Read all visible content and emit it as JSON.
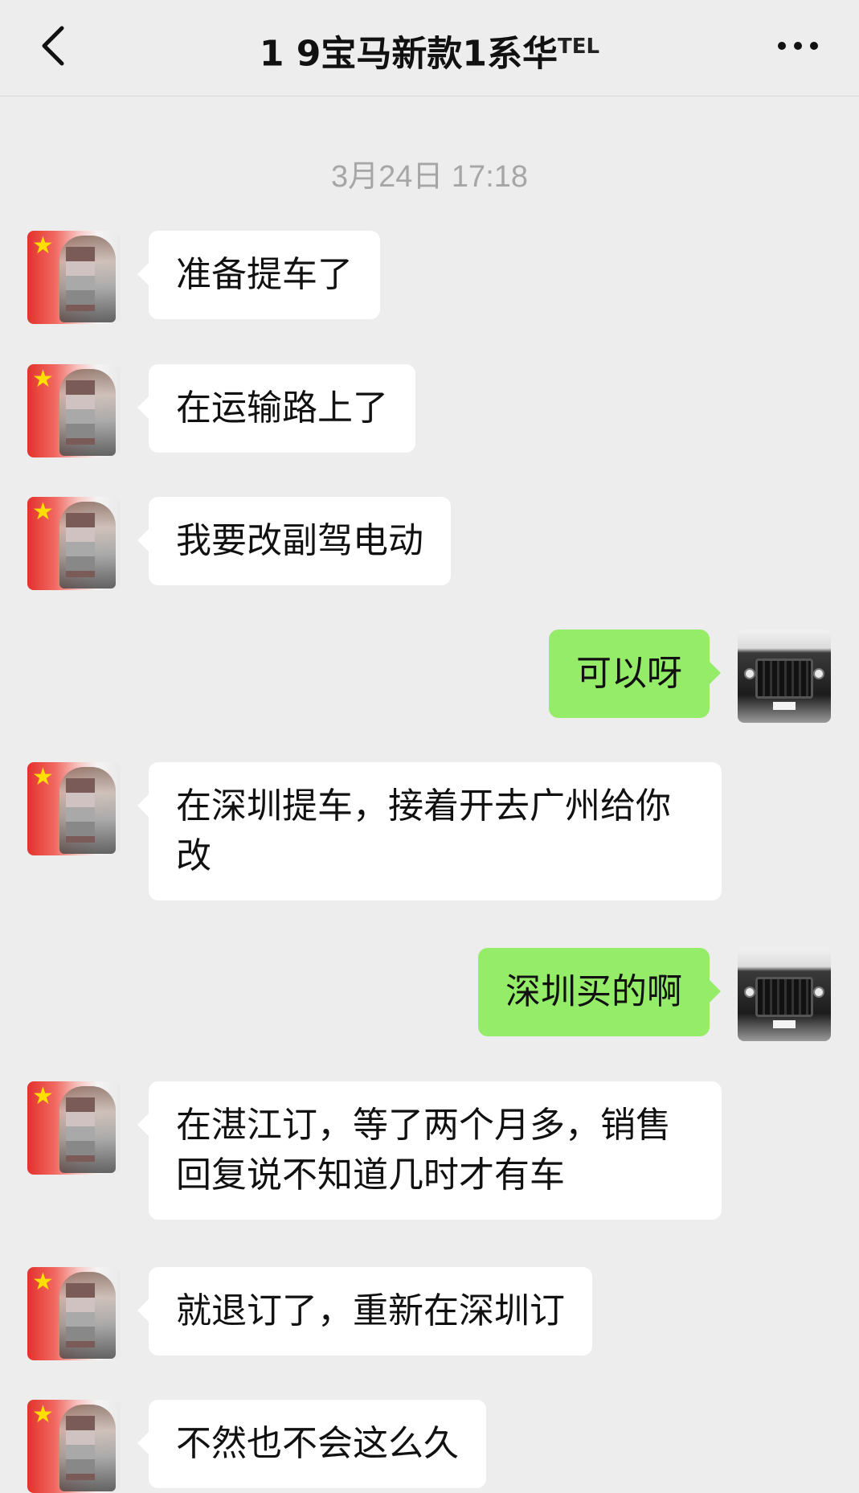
{
  "header": {
    "title": "1  9宝马新款1系华",
    "title_suffix": "TEL"
  },
  "timestamp": "3月24日 17:18",
  "messages": [
    {
      "side": "left",
      "text": "准备提车了"
    },
    {
      "side": "left",
      "text": "在运输路上了"
    },
    {
      "side": "left",
      "text": "我要改副驾电动"
    },
    {
      "side": "right",
      "text": "可以呀"
    },
    {
      "side": "left",
      "text": "在深圳提车，接着开去广州给你改"
    },
    {
      "side": "right",
      "text": "深圳买的啊"
    },
    {
      "side": "left",
      "text": "在湛江订，等了两个月多，销售回复说不知道几时才有车"
    },
    {
      "side": "left",
      "text": "就退订了，重新在深圳订"
    },
    {
      "side": "left",
      "text": "不然也不会这么久"
    }
  ],
  "colors": {
    "background": "#ededed",
    "bubble_self": "#95ec69",
    "bubble_other": "#ffffff",
    "timestamp": "#a6a6a6"
  },
  "icons": {
    "back": "chevron-left-icon",
    "more": "more-dots-icon"
  }
}
